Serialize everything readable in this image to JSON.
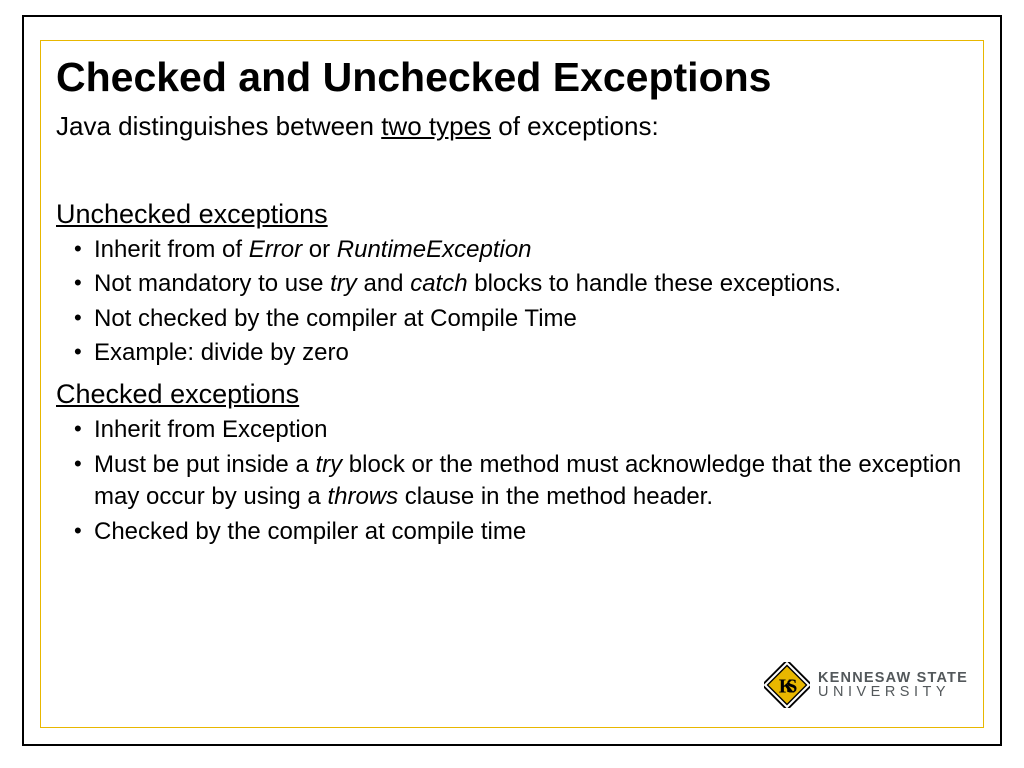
{
  "title": "Checked and Unchecked Exceptions",
  "intro_pre": "Java distinguishes between ",
  "intro_u": "two types",
  "intro_post": " of exceptions:",
  "section1": {
    "heading": "Unchecked exceptions",
    "b1_pre": "Inherit from of ",
    "b1_i1": "Error",
    "b1_mid": " or ",
    "b1_i2": "RuntimeException",
    "b2_pre": "Not mandatory to use ",
    "b2_i1": "try",
    "b2_mid": " and ",
    "b2_i2": "catch",
    "b2_post": " blocks to handle these exceptions.",
    "b3": "Not checked by the compiler at Compile Time",
    "b4": "Example: divide by zero"
  },
  "section2": {
    "heading": "Checked exceptions",
    "b1": "Inherit from Exception",
    "b2_pre": "Must be put inside a ",
    "b2_i1": "try",
    "b2_mid": " block or the method must acknowledge that the exception may occur by using a ",
    "b2_i2": "throws",
    "b2_post": " clause in the method header.",
    "b3": "Checked by the compiler at compile time"
  },
  "logo": {
    "line1": "KENNESAW STATE",
    "line2": "UNIVERSITY"
  }
}
